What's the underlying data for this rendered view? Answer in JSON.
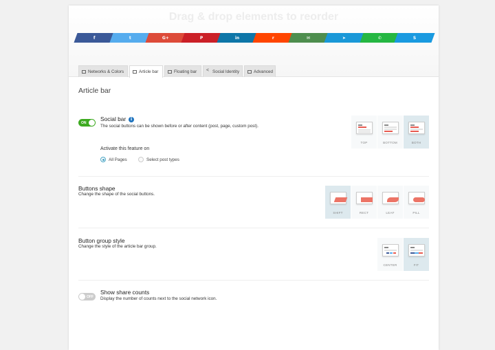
{
  "header": {
    "title": "Drag & drop elements to reorder"
  },
  "social_buttons": [
    {
      "name": "facebook",
      "glyph": "f",
      "color": "#3b5998"
    },
    {
      "name": "twitter",
      "glyph": "t",
      "color": "#55acee"
    },
    {
      "name": "google-plus",
      "glyph": "G+",
      "color": "#dd4b39"
    },
    {
      "name": "pinterest",
      "glyph": "P",
      "color": "#cb2027"
    },
    {
      "name": "linkedin",
      "glyph": "in",
      "color": "#0e76a8"
    },
    {
      "name": "reddit",
      "glyph": "r",
      "color": "#ff4500"
    },
    {
      "name": "email",
      "glyph": "✉",
      "color": "#4e8e4e"
    },
    {
      "name": "telegram",
      "glyph": "➤",
      "color": "#1a98d8"
    },
    {
      "name": "whatsapp",
      "glyph": "✆",
      "color": "#25b742"
    },
    {
      "name": "skype",
      "glyph": "S",
      "color": "#1a9ae0"
    }
  ],
  "tabs": [
    {
      "label": "Networks & Colors",
      "icon": "palette-icon",
      "active": false
    },
    {
      "label": "Article bar",
      "icon": "menu-icon",
      "active": true
    },
    {
      "label": "Floating bar",
      "icon": "window-icon",
      "active": false
    },
    {
      "label": "Social Identity",
      "icon": "share-icon",
      "active": false
    },
    {
      "label": "Advanced",
      "icon": "settings-icon",
      "active": false
    }
  ],
  "section_title": "Article bar",
  "social_bar": {
    "toggle_label": "ON",
    "toggle_on": true,
    "title": "Social bar",
    "info_glyph": "i",
    "description": "The social buttons can be shown before or after content (post, page, custom post).",
    "positions": [
      {
        "label": "TOP",
        "selected": false
      },
      {
        "label": "BOTTOM",
        "selected": false
      },
      {
        "label": "BOTH",
        "selected": true
      }
    ],
    "activate_label": "Activate this feature on",
    "radio_options": [
      {
        "label": "All Pages",
        "selected": true
      },
      {
        "label": "Select post types",
        "selected": false
      }
    ]
  },
  "buttons_shape": {
    "title": "Buttons shape",
    "description": "Change the shape of the social buttons.",
    "options": [
      {
        "label": "SHIFT",
        "selected": true
      },
      {
        "label": "RECT",
        "selected": false
      },
      {
        "label": "LEAF",
        "selected": false
      },
      {
        "label": "PILL",
        "selected": false
      }
    ]
  },
  "button_group_style": {
    "title": "Button group style",
    "description": "Change the style of the article bar group.",
    "options": [
      {
        "label": "CENTER",
        "selected": false
      },
      {
        "label": "FIT",
        "selected": true
      }
    ]
  },
  "share_counts": {
    "toggle_label": "OFF",
    "toggle_on": false,
    "title": "Show share counts",
    "description": "Display the number of counts next to the social network icon."
  }
}
